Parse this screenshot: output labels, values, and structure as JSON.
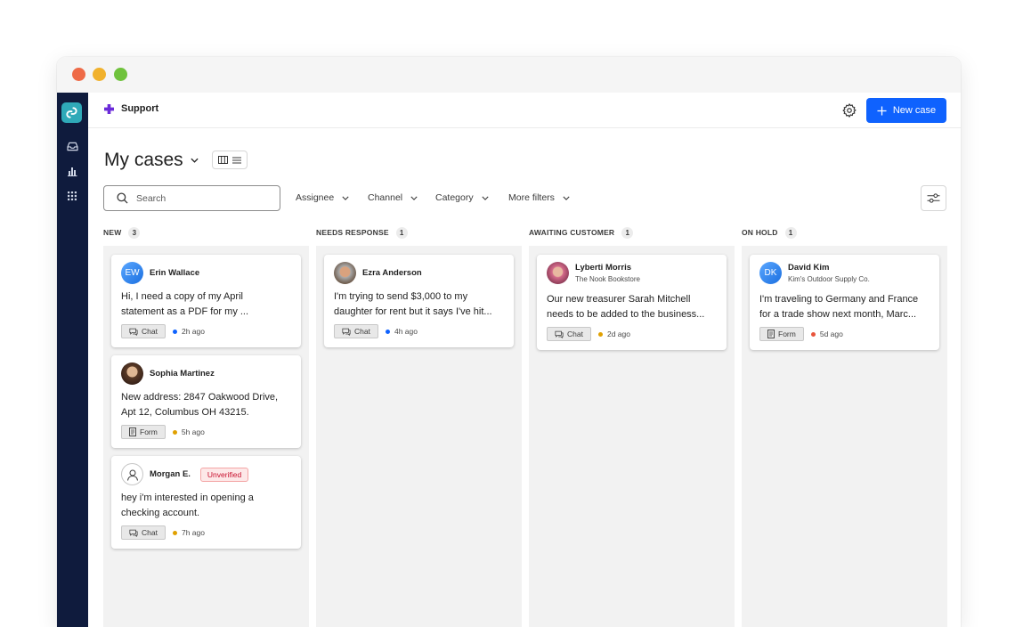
{
  "topbar": {
    "app_name": "Support",
    "new_case_label": "New case"
  },
  "page": {
    "title": "My cases"
  },
  "search": {
    "placeholder": "Search"
  },
  "filters": [
    {
      "label": "Assignee"
    },
    {
      "label": "Channel"
    },
    {
      "label": "Category"
    },
    {
      "label": "More filters"
    }
  ],
  "colors": {
    "accent": "#0f62fe",
    "rail": "#0f1b3d",
    "new_dot": "#0f62fe",
    "warn_dot": "#e0a000",
    "danger_dot": "#e8543c"
  },
  "columns": [
    {
      "title": "NEW",
      "count": "3",
      "cards": [
        {
          "name": "Erin Wallace",
          "initials": "EW",
          "line1": "Hi, I need a copy of my April",
          "line2": "statement as a PDF for my ...",
          "channel": "Chat",
          "time": "2h ago"
        },
        {
          "name": "Sophia Martinez",
          "line1": "New address: 2847 Oakwood Drive,",
          "line2": "Apt 12, Columbus OH 43215.",
          "channel": "Form",
          "time": "5h ago"
        },
        {
          "name": "Morgan E.",
          "badge": "Unverified",
          "line1": "hey i'm interested in opening a",
          "line2": "checking account.",
          "channel": "Chat",
          "time": "7h ago"
        }
      ]
    },
    {
      "title": "NEEDS RESPONSE",
      "count": "1",
      "cards": [
        {
          "name": "Ezra Anderson",
          "line1": "I'm trying to send $3,000 to my",
          "line2": "daughter for rent but it says I've hit...",
          "channel": "Chat",
          "time": "4h ago"
        }
      ]
    },
    {
      "title": "AWAITING CUSTOMER",
      "count": "1",
      "cards": [
        {
          "name": "Lyberti Morris",
          "company": "The Nook Bookstore",
          "line1": "Our new treasurer Sarah Mitchell",
          "line2": "needs to be added to the business...",
          "channel": "Chat",
          "time": "2d ago"
        }
      ]
    },
    {
      "title": "ON HOLD",
      "count": "1",
      "cards": [
        {
          "name": "David Kim",
          "initials": "DK",
          "company": "Kim's Outdoor Supply Co.",
          "line1": "I'm traveling to Germany and France",
          "line2": "for a trade show next month, Marc...",
          "channel": "Form",
          "time": "5d ago"
        }
      ]
    }
  ]
}
